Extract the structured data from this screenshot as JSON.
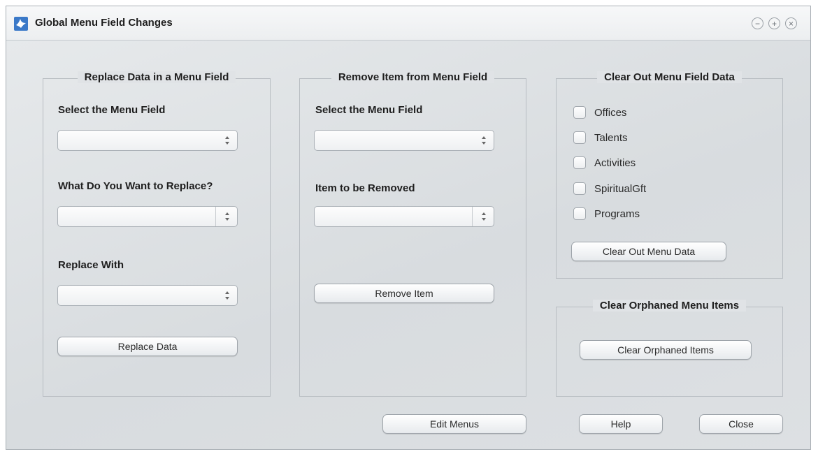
{
  "window": {
    "title": "Global Menu Field Changes",
    "controls": {
      "minimize": "−",
      "maximize": "+",
      "close": "×"
    }
  },
  "replace_group": {
    "title": "Replace Data in a Menu Field",
    "select_label": "Select the Menu Field",
    "select_value": "",
    "replace_label": "What Do You Want to Replace?",
    "replace_value": "",
    "with_label": "Replace With",
    "with_value": "",
    "button": "Replace Data"
  },
  "remove_group": {
    "title": "Remove Item from Menu Field",
    "select_label": "Select the Menu Field",
    "select_value": "",
    "item_label": "Item to be Removed",
    "item_value": "",
    "button": "Remove Item"
  },
  "clear_group": {
    "title": "Clear Out Menu Field Data",
    "checkboxes": [
      {
        "label": "Offices",
        "checked": false
      },
      {
        "label": "Talents",
        "checked": false
      },
      {
        "label": "Activities",
        "checked": false
      },
      {
        "label": "SpiritualGft",
        "checked": false
      },
      {
        "label": "Programs",
        "checked": false
      }
    ],
    "button": "Clear Out Menu Data"
  },
  "orphan_group": {
    "title": "Clear Orphaned Menu Items",
    "button": "Clear Orphaned Items"
  },
  "footer": {
    "edit_menus": "Edit Menus",
    "help": "Help",
    "close": "Close"
  },
  "icons": {
    "app": "bird-logo-icon",
    "spinner": "spinner-arrows-icon"
  },
  "colors": {
    "app_icon": "#3b79c8"
  }
}
